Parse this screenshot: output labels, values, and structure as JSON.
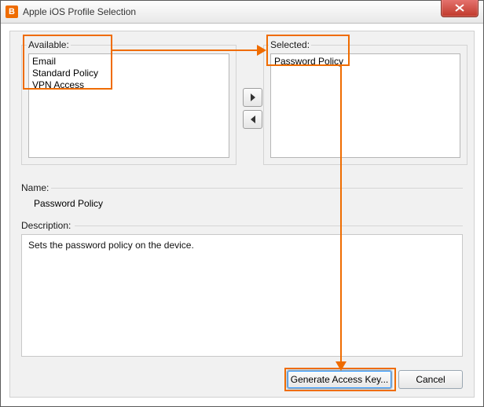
{
  "window": {
    "title": "Apple iOS Profile Selection",
    "app_icon_letter": "B"
  },
  "panels": {
    "available": {
      "legend": "Available:",
      "items": [
        "Email",
        "Standard Policy",
        "VPN Access"
      ]
    },
    "selected": {
      "legend": "Selected:",
      "items": [
        "Password Policy"
      ]
    }
  },
  "labels": {
    "name": "Name:",
    "description": "Description:"
  },
  "values": {
    "name": "Password Policy",
    "description": "Sets the password policy on the device."
  },
  "buttons": {
    "generate": "Generate Access Key...",
    "cancel": "Cancel"
  }
}
